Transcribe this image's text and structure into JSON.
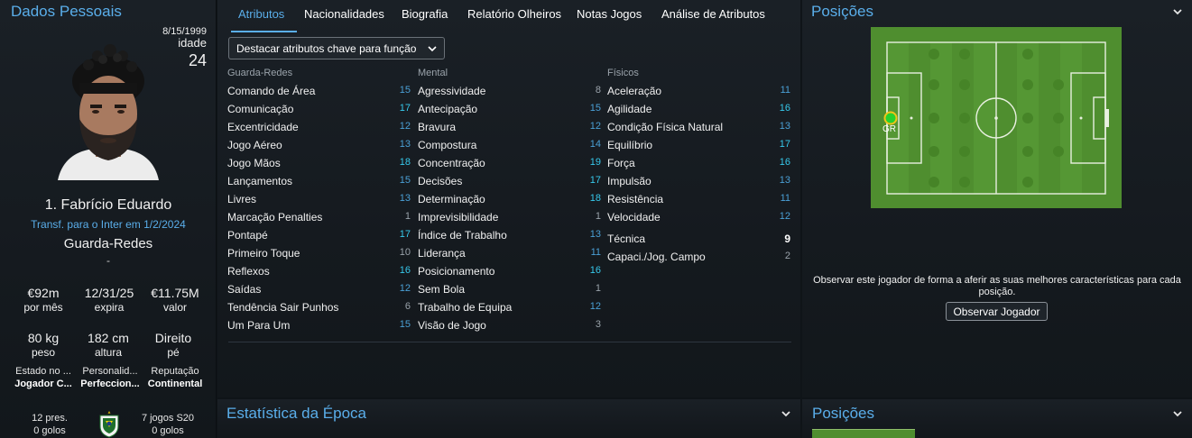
{
  "left": {
    "title": "Dados Pessoais",
    "dob": "8/15/1999",
    "age_label": "idade",
    "age": "24",
    "name": "1. Fabrício Eduardo",
    "transfer": "Transf. para o Inter em 1/2/2024",
    "position": "Guarda-Redes",
    "dash": "-",
    "stats_row1": [
      {
        "value": "€92m",
        "label": "por mês"
      },
      {
        "value": "12/31/25",
        "label": "expira"
      },
      {
        "value": "€11.75M",
        "label": "valor"
      }
    ],
    "stats_row2": [
      {
        "value": "80 kg",
        "label": "peso"
      },
      {
        "value": "182 cm",
        "label": "altura"
      },
      {
        "value": "Direito",
        "label": "pé"
      }
    ],
    "stats_row3": [
      {
        "label": "Estado no ...",
        "value": "Jogador C..."
      },
      {
        "label": "Personalid...",
        "value": "Perfeccion..."
      },
      {
        "label": "Reputação",
        "value": "Continental"
      }
    ],
    "intl_left": {
      "line1": "12 pres.",
      "line2": "0 golos"
    },
    "intl_right": {
      "line1": "7 jogos S20",
      "line2": "0 golos"
    }
  },
  "tabs": [
    {
      "label": "Atributos",
      "active": true
    },
    {
      "label": "Nacionalidades"
    },
    {
      "label": "Biografia"
    },
    {
      "label": "Relatório Olheiros"
    },
    {
      "label": "Notas Jogos"
    },
    {
      "label": "Análise de Atributos"
    }
  ],
  "dropdown_label": "Destacar atributos chave para função",
  "columns": [
    {
      "header": "Guarda-Redes",
      "rows": [
        {
          "name": "Comando de Área",
          "value": "15"
        },
        {
          "name": "Comunicação",
          "value": "17"
        },
        {
          "name": "Excentricidade",
          "value": "12"
        },
        {
          "name": "Jogo Aéreo",
          "value": "13"
        },
        {
          "name": "Jogo Mãos",
          "value": "18"
        },
        {
          "name": "Lançamentos",
          "value": "15"
        },
        {
          "name": "Livres",
          "value": "13"
        },
        {
          "name": "Marcação Penalties",
          "value": "1"
        },
        {
          "name": "Pontapé",
          "value": "17"
        },
        {
          "name": "Primeiro Toque",
          "value": "10"
        },
        {
          "name": "Reflexos",
          "value": "16"
        },
        {
          "name": "Saídas",
          "value": "12"
        },
        {
          "name": "Tendência Sair Punhos",
          "value": "6"
        },
        {
          "name": "Um Para Um",
          "value": "15"
        }
      ]
    },
    {
      "header": "Mental",
      "rows": [
        {
          "name": "Agressividade",
          "value": "8"
        },
        {
          "name": "Antecipação",
          "value": "15"
        },
        {
          "name": "Bravura",
          "value": "12"
        },
        {
          "name": "Compostura",
          "value": "14"
        },
        {
          "name": "Concentração",
          "value": "19"
        },
        {
          "name": "Decisões",
          "value": "17"
        },
        {
          "name": "Determinação",
          "value": "18"
        },
        {
          "name": "Imprevisibilidade",
          "value": "1"
        },
        {
          "name": "Índice de Trabalho",
          "value": "13"
        },
        {
          "name": "Liderança",
          "value": "11"
        },
        {
          "name": "Posicionamento",
          "value": "16"
        },
        {
          "name": "Sem Bola",
          "value": "1"
        },
        {
          "name": "Trabalho de Equipa",
          "value": "12"
        },
        {
          "name": "Visão de Jogo",
          "value": "3"
        }
      ]
    },
    {
      "header": "Físicos",
      "rows": [
        {
          "name": "Aceleração",
          "value": "11"
        },
        {
          "name": "Agilidade",
          "value": "16"
        },
        {
          "name": "Condição Física Natural",
          "value": "13"
        },
        {
          "name": "Equilíbrio",
          "value": "17"
        },
        {
          "name": "Força",
          "value": "16"
        },
        {
          "name": "Impulsão",
          "value": "13"
        },
        {
          "name": "Resistência",
          "value": "11"
        },
        {
          "name": "Velocidade",
          "value": "12"
        }
      ],
      "extra_rows": [
        {
          "name": "Técnica",
          "value": "9"
        },
        {
          "name": "Capaci./Jog. Campo",
          "value": "2"
        }
      ]
    }
  ],
  "season_stats_title": "Estatística da Época",
  "positions": {
    "title": "Posições",
    "marker_label": "GR",
    "advice": "Observar este jogador de forma a aferir as suas melhores características para cada posição.",
    "button": "Observar Jogador"
  },
  "positions2_title": "Posições",
  "colors": {
    "accent": "#5aaeea",
    "pitch": "#4f8e2f",
    "value_cyan": "#36c9ec",
    "value_grey": "#9aa3ab",
    "value_white": "#ffffff"
  }
}
